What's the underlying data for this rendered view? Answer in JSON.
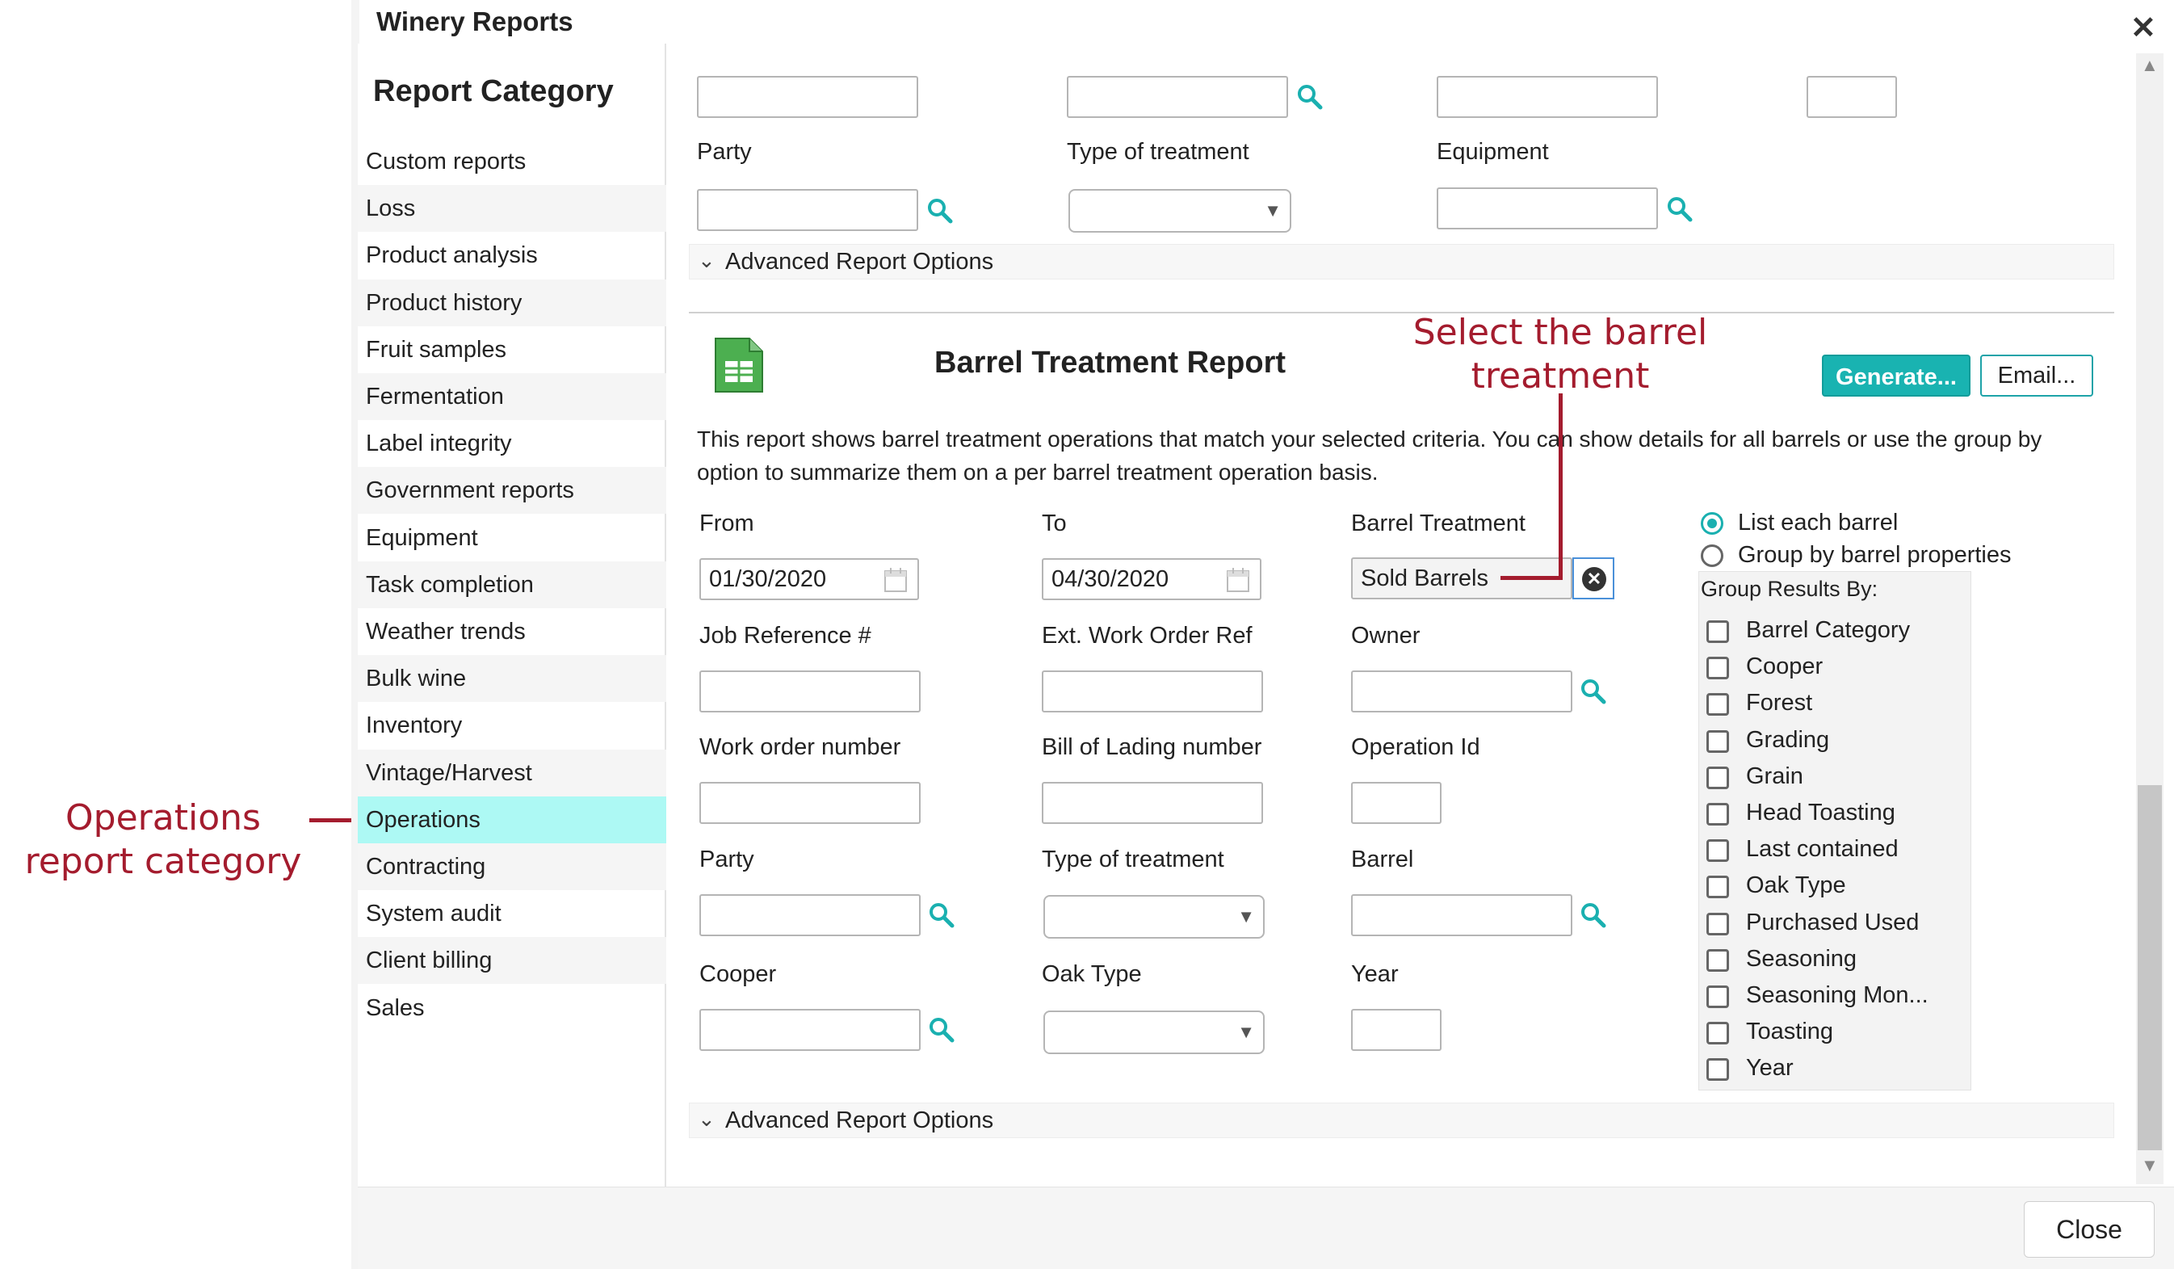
{
  "window": {
    "title": "Winery Reports",
    "close_glyph": "✕"
  },
  "annotations": {
    "operations": "Operations\nreport category",
    "treatment": "Select the barrel\ntreatment",
    "color": "#a41c2e"
  },
  "sidebar": {
    "heading": "Report Category",
    "items": [
      {
        "label": "Custom reports"
      },
      {
        "label": "Loss"
      },
      {
        "label": "Product analysis"
      },
      {
        "label": "Product history"
      },
      {
        "label": "Fruit samples"
      },
      {
        "label": "Fermentation"
      },
      {
        "label": "Label integrity"
      },
      {
        "label": "Government reports"
      },
      {
        "label": "Equipment"
      },
      {
        "label": "Task completion"
      },
      {
        "label": "Weather trends"
      },
      {
        "label": "Bulk wine"
      },
      {
        "label": "Inventory"
      },
      {
        "label": "Vintage/Harvest"
      },
      {
        "label": "Operations"
      },
      {
        "label": "Contracting"
      },
      {
        "label": "System audit"
      },
      {
        "label": "Client billing"
      },
      {
        "label": "Sales"
      }
    ],
    "active_index": 14,
    "active_color": "#adf9f4"
  },
  "upper_form": {
    "party_label": "Party",
    "type_label": "Type of treatment",
    "equipment_label": "Equipment",
    "advanced": "Advanced Report Options"
  },
  "report": {
    "title": "Barrel Treatment Report",
    "icon": "excel-report-icon",
    "generate": "Generate...",
    "email": "Email...",
    "description": "This report shows barrel treatment operations that match your selected criteria. You can show details for all barrels or use the group by option to summarize them on a per barrel treatment operation basis.",
    "fields": {
      "from_label": "From",
      "from_value": "01/30/2020",
      "to_label": "To",
      "to_value": "04/30/2020",
      "treatment_label": "Barrel Treatment",
      "treatment_value": "Sold Barrels",
      "job_label": "Job Reference #",
      "ext_label": "Ext. Work Order Ref",
      "owner_label": "Owner",
      "wo_label": "Work order number",
      "bol_label": "Bill of Lading number",
      "opid_label": "Operation Id",
      "party_label": "Party",
      "type_label": "Type of treatment",
      "barrel_label": "Barrel",
      "cooper_label": "Cooper",
      "oak_label": "Oak Type",
      "year_label": "Year"
    },
    "radio_list": "List each barrel",
    "radio_group": "Group by barrel properties",
    "group_heading": "Group Results By:",
    "group_options": [
      {
        "label": "Barrel Category"
      },
      {
        "label": "Cooper"
      },
      {
        "label": "Forest"
      },
      {
        "label": "Grading"
      },
      {
        "label": "Grain"
      },
      {
        "label": "Head Toasting"
      },
      {
        "label": "Last contained"
      },
      {
        "label": "Oak Type"
      },
      {
        "label": "Purchased Used"
      },
      {
        "label": "Seasoning"
      },
      {
        "label": "Seasoning Mon..."
      },
      {
        "label": "Toasting"
      },
      {
        "label": "Year"
      }
    ],
    "advanced": "Advanced Report Options"
  },
  "footer": {
    "close": "Close"
  },
  "colors": {
    "accent": "#19b3b1",
    "search_icon": "#1ab0b0"
  }
}
